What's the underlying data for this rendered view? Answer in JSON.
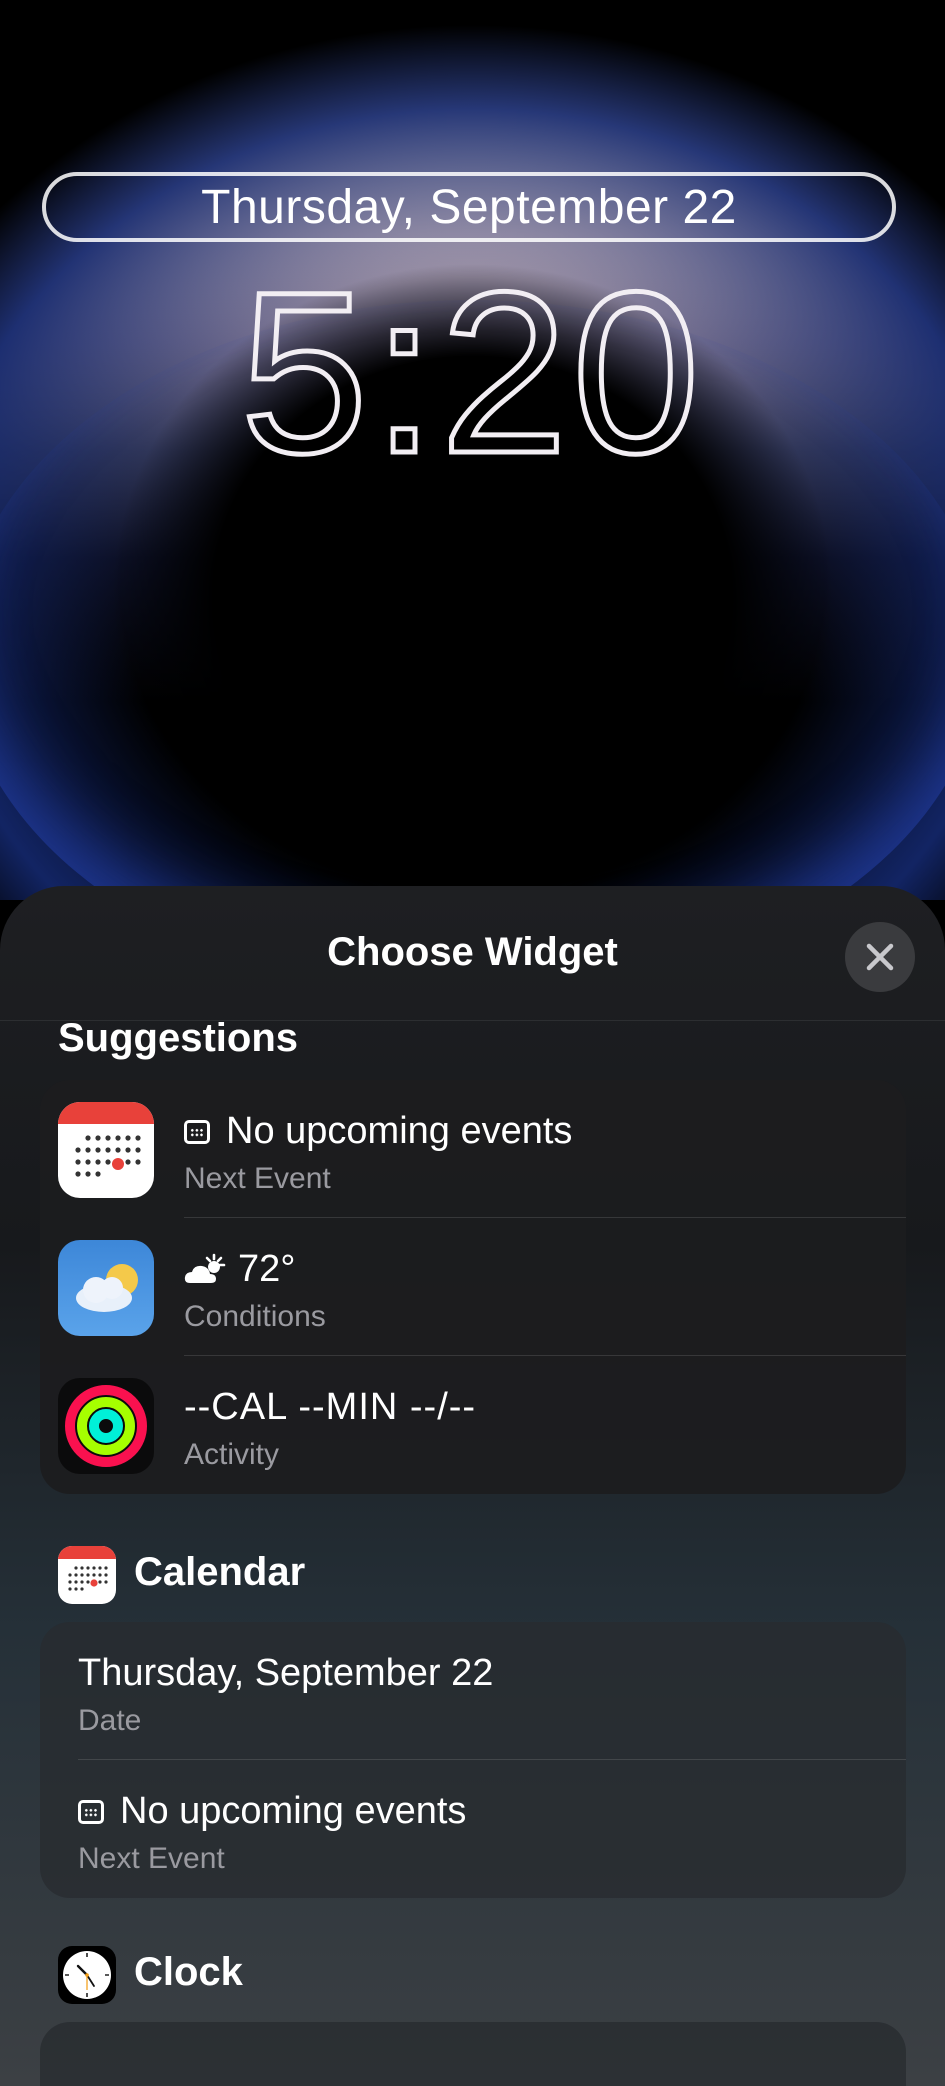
{
  "lockscreen": {
    "date": "Thursday, September 22",
    "time": "5:20"
  },
  "sheet": {
    "title": "Choose Widget",
    "close_icon": "close-icon"
  },
  "suggestions": {
    "label": "Suggestions",
    "items": [
      {
        "icon": "calendar-app-icon",
        "glyph": "calendar-glyph-icon",
        "main": "No upcoming events",
        "sub": "Next Event"
      },
      {
        "icon": "weather-app-icon",
        "glyph": "partly-sunny-icon",
        "main": "72°",
        "sub": "Conditions"
      },
      {
        "icon": "activity-app-icon",
        "main": "--CAL --MIN --/--",
        "sub": "Activity"
      }
    ]
  },
  "calendar_section": {
    "label": "Calendar",
    "items": [
      {
        "main": "Thursday, September 22",
        "sub": "Date"
      },
      {
        "glyph": "calendar-glyph-icon",
        "main": "No upcoming events",
        "sub": "Next Event"
      }
    ]
  },
  "clock_section": {
    "label": "Clock"
  },
  "colors": {
    "sheet_bg": "#1c1c1e",
    "calendar_red": "#e8413a",
    "activity_red": "#fa114f",
    "activity_green": "#a6ff00",
    "activity_blue": "#00f0d8"
  }
}
